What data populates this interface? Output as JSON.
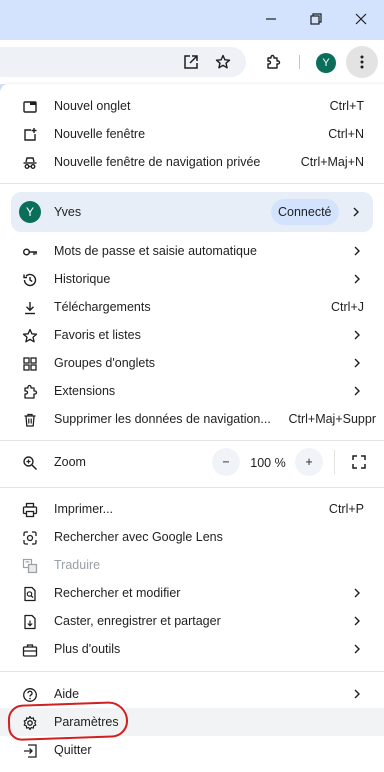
{
  "titlebar": {
    "minimize": "—",
    "restore": "⧉",
    "close": "✕"
  },
  "toolbar": {
    "avatar_letter": "Y",
    "menu_glyph": "⋮"
  },
  "menu": {
    "new_tab": {
      "label": "Nouvel onglet",
      "shortcut": "Ctrl+T"
    },
    "new_window": {
      "label": "Nouvelle fenêtre",
      "shortcut": "Ctrl+N"
    },
    "incognito": {
      "label": "Nouvelle fenêtre de navigation privée",
      "shortcut": "Ctrl+Maj+N"
    },
    "profile": {
      "avatar_letter": "Y",
      "name": "Yves",
      "status": "Connecté"
    },
    "passwords": {
      "label": "Mots de passe et saisie automatique"
    },
    "history": {
      "label": "Historique"
    },
    "downloads": {
      "label": "Téléchargements",
      "shortcut": "Ctrl+J"
    },
    "bookmarks": {
      "label": "Favoris et listes"
    },
    "tab_groups": {
      "label": "Groupes d'onglets"
    },
    "extensions": {
      "label": "Extensions"
    },
    "clear_data": {
      "label": "Supprimer les données de navigation...",
      "shortcut": "Ctrl+Maj+Suppr"
    },
    "zoom": {
      "label": "Zoom",
      "minus": "−",
      "value": "100 %",
      "plus": "+"
    },
    "print": {
      "label": "Imprimer...",
      "shortcut": "Ctrl+P"
    },
    "lens": {
      "label": "Rechercher avec Google Lens"
    },
    "translate": {
      "label": "Traduire"
    },
    "find_edit": {
      "label": "Rechercher et modifier"
    },
    "cast": {
      "label": "Caster, enregistrer et partager"
    },
    "more_tools": {
      "label": "Plus d'outils"
    },
    "help": {
      "label": "Aide"
    },
    "settings": {
      "label": "Paramètres"
    },
    "quit": {
      "label": "Quitter"
    }
  },
  "colors": {
    "accent": "#0b6e5a",
    "annotation": "#d12020",
    "chrome_bg": "#d3e3fd"
  }
}
